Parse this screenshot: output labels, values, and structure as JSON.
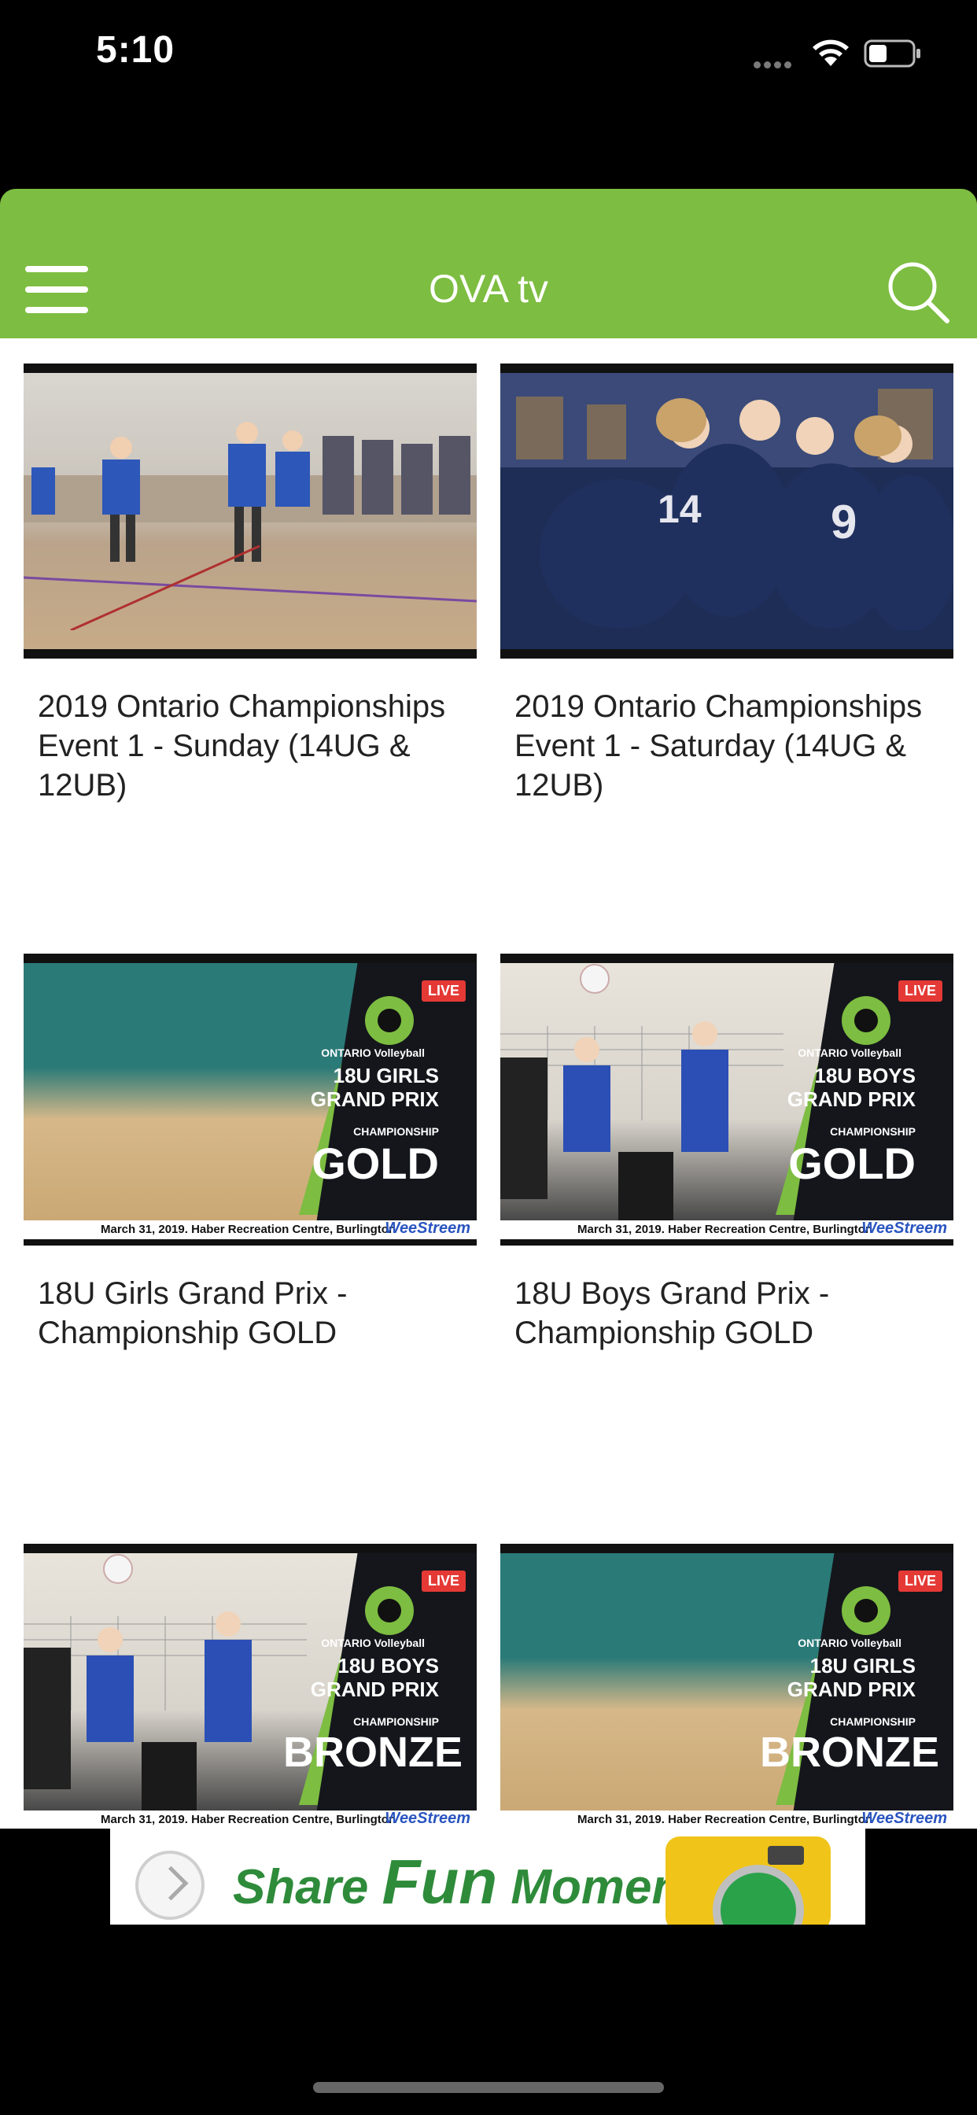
{
  "status_bar": {
    "time": "5:10"
  },
  "header": {
    "title": "OVA tv",
    "bg_color": "#7dbd41"
  },
  "videos": [
    {
      "title": "2019 Ontario Championships Event 1 - Sunday (14UG & 12UB)"
    },
    {
      "title": "2019 Ontario Championships Event 1 - Saturday (14UG & 12UB)"
    },
    {
      "title": "18U Girls Grand Prix - Championship GOLD",
      "thumb": {
        "live": "LIVE",
        "brand": "ONTARIO Volleyball",
        "line1": "18U GIRLS",
        "line2": "GRAND PRIX",
        "sub": "CHAMPIONSHIP",
        "medal": "GOLD",
        "footer": "March 31, 2019. Haber Recreation Centre, Burlington",
        "logo": "WeeStreem"
      }
    },
    {
      "title": "18U Boys Grand Prix - Championship GOLD",
      "thumb": {
        "live": "LIVE",
        "brand": "ONTARIO Volleyball",
        "line1": "18U BOYS",
        "line2": "GRAND PRIX",
        "sub": "CHAMPIONSHIP",
        "medal": "GOLD",
        "footer": "March 31, 2019. Haber Recreation Centre, Burlington",
        "logo": "WeeStreem"
      }
    },
    {
      "title": "",
      "thumb": {
        "live": "LIVE",
        "brand": "ONTARIO Volleyball",
        "line1": "18U BOYS",
        "line2": "GRAND PRIX",
        "sub": "CHAMPIONSHIP",
        "medal": "BRONZE",
        "footer": "March 31, 2019. Haber Recreation Centre, Burlington",
        "logo": "WeeStreem"
      }
    },
    {
      "title": "",
      "thumb": {
        "live": "LIVE",
        "brand": "ONTARIO Volleyball",
        "line1": "18U GIRLS",
        "line2": "GRAND PRIX",
        "sub": "CHAMPIONSHIP",
        "medal": "BRONZE",
        "footer": "March 31, 2019. Haber Recreation Centre, Burlington",
        "logo": "WeeStreem"
      }
    }
  ],
  "ad": {
    "text_1": "Share ",
    "text_big": "Fun",
    "text_2": " Moments"
  }
}
